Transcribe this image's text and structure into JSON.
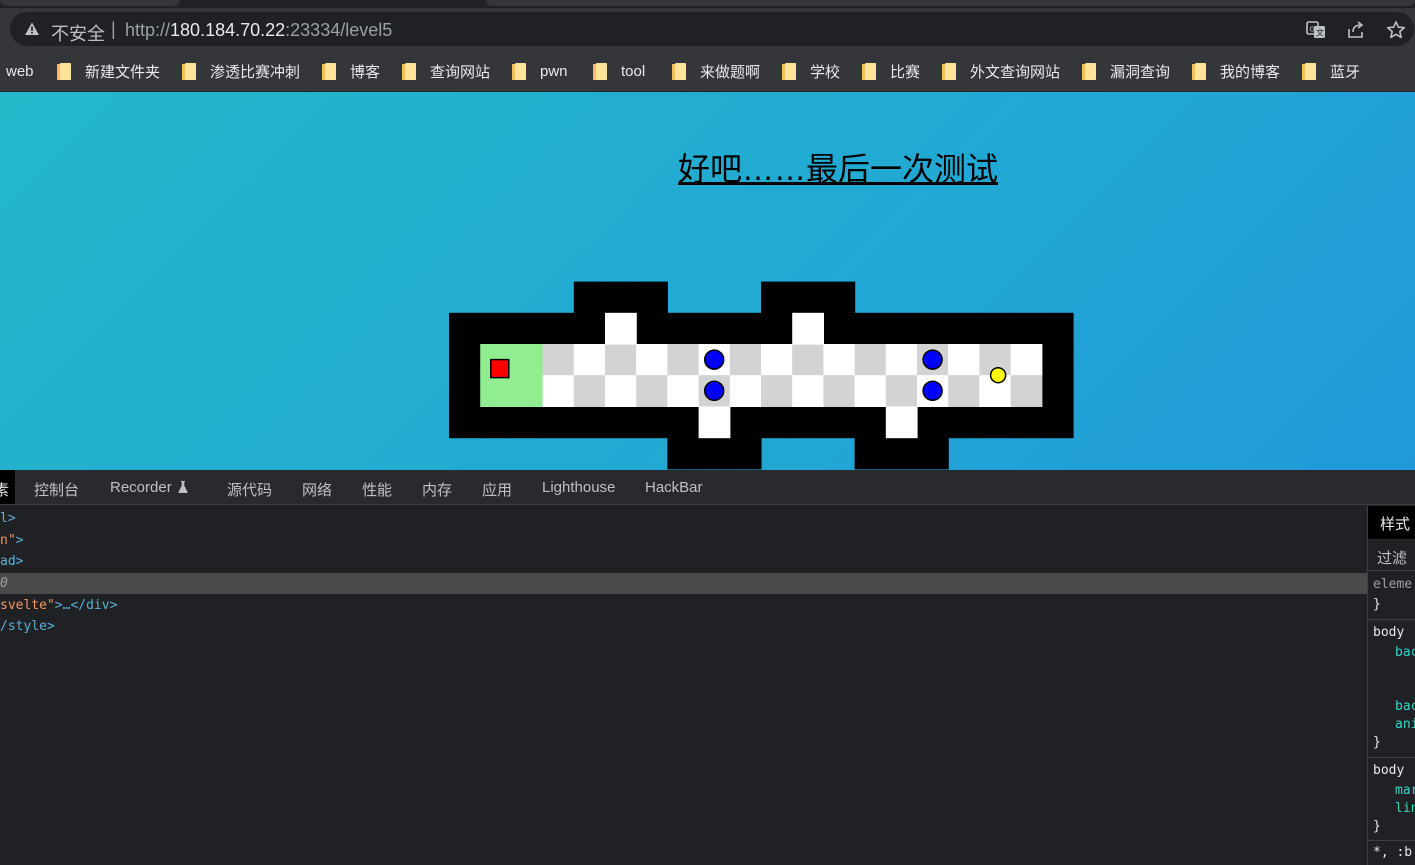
{
  "browser": {
    "security_label": "不安全",
    "separator": "|",
    "url_scheme": "http://",
    "url_host": "180.184.70.22",
    "url_rest": ":23334/level5"
  },
  "bookmarks": [
    {
      "label": "web"
    },
    {
      "label": "新建文件夹"
    },
    {
      "label": "渗透比赛冲刺"
    },
    {
      "label": "博客"
    },
    {
      "label": "查询网站"
    },
    {
      "label": "pwn"
    },
    {
      "label": "tool"
    },
    {
      "label": "来做题啊"
    },
    {
      "label": "学校"
    },
    {
      "label": "比赛"
    },
    {
      "label": "外文查询网站"
    },
    {
      "label": "漏洞查询"
    },
    {
      "label": "我的博客"
    },
    {
      "label": "蓝牙"
    }
  ],
  "game": {
    "title": "好吧……最后一次测试",
    "colors": {
      "wall": "#000000",
      "tile_light": "#ffffff",
      "tile_dark": "#d3d3d3",
      "start": "#90ee90",
      "player": "#ff0000",
      "enemy": "#0000ff",
      "coin": "#ffff00"
    },
    "open_cells": [
      [
        1,
        0
      ],
      [
        2,
        0
      ],
      [
        3,
        0
      ],
      [
        4,
        0
      ],
      [
        5,
        0
      ],
      [
        6,
        0
      ],
      [
        7,
        0
      ],
      [
        8,
        0
      ],
      [
        9,
        0
      ],
      [
        10,
        0
      ],
      [
        11,
        0
      ],
      [
        12,
        0
      ],
      [
        13,
        0
      ],
      [
        14,
        0
      ],
      [
        15,
        0
      ],
      [
        16,
        0
      ],
      [
        17,
        0
      ],
      [
        18,
        0
      ],
      [
        1,
        1
      ],
      [
        2,
        1
      ],
      [
        3,
        1
      ],
      [
        4,
        1
      ],
      [
        5,
        1
      ],
      [
        6,
        1
      ],
      [
        7,
        1
      ],
      [
        8,
        1
      ],
      [
        9,
        1
      ],
      [
        10,
        1
      ],
      [
        11,
        1
      ],
      [
        12,
        1
      ],
      [
        13,
        1
      ],
      [
        14,
        1
      ],
      [
        15,
        1
      ],
      [
        16,
        1
      ],
      [
        17,
        1
      ],
      [
        18,
        1
      ],
      [
        5,
        -1
      ],
      [
        11,
        -1
      ],
      [
        8,
        2
      ],
      [
        14,
        2
      ]
    ],
    "start_cells": [
      [
        1,
        0
      ],
      [
        2,
        0
      ],
      [
        1,
        1
      ],
      [
        2,
        1
      ]
    ],
    "player_cell": [
      1,
      0
    ],
    "enemies": [
      [
        8,
        0
      ],
      [
        8,
        1
      ],
      [
        15,
        0
      ],
      [
        15,
        1
      ]
    ],
    "coin": [
      17.1,
      0.5
    ]
  },
  "devtools": {
    "tabs": [
      {
        "label": "素"
      },
      {
        "label": "控制台"
      },
      {
        "label": "Recorder"
      },
      {
        "label": "源代码"
      },
      {
        "label": "网络"
      },
      {
        "label": "性能"
      },
      {
        "label": "内存"
      },
      {
        "label": "应用"
      },
      {
        "label": "Lighthouse"
      },
      {
        "label": "HackBar"
      }
    ],
    "dom_lines": [
      {
        "tag": "l>",
        "attr": "",
        "rest": ""
      },
      {
        "tag": "",
        "attr": "n\"",
        "rest": ">"
      },
      {
        "tag": "ad>",
        "attr": "",
        "rest": ""
      },
      {
        "tag": "",
        "attr": "",
        "rest": "0"
      },
      {
        "tag": "",
        "attr": "svelte\"",
        "rest": ">…</div>"
      },
      {
        "tag": "/style>",
        "attr": "",
        "rest": ""
      }
    ],
    "styles_tab": "样式",
    "filter_label": "过滤",
    "styles_lines": [
      "eleme",
      "}",
      "body",
      "bac",
      "bac",
      "ani",
      "}",
      "body",
      "mar",
      "lin",
      "}",
      "*, :b"
    ]
  }
}
